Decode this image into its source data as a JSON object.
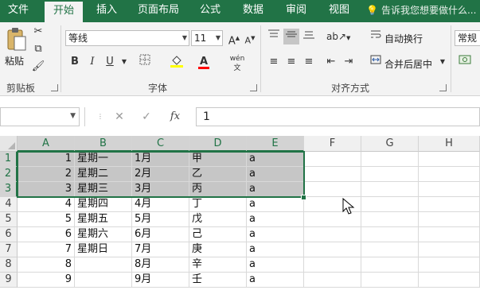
{
  "tabs": [
    {
      "label": "文件",
      "active": false
    },
    {
      "label": "开始",
      "active": true
    },
    {
      "label": "插入",
      "active": false
    },
    {
      "label": "页面布局",
      "active": false
    },
    {
      "label": "公式",
      "active": false
    },
    {
      "label": "数据",
      "active": false
    },
    {
      "label": "审阅",
      "active": false
    },
    {
      "label": "视图",
      "active": false
    }
  ],
  "tell_me": "告诉我您想要做什么...",
  "ribbon": {
    "clipboard": {
      "paste_label": "粘贴",
      "group_label": "剪贴板"
    },
    "font": {
      "name": "等线",
      "size": "11",
      "group_label": "字体",
      "bold": "B",
      "italic": "I",
      "underline": "U",
      "grow": "A",
      "shrink": "A",
      "font_color_glyph": "A",
      "phonetic_glyph": "wén"
    },
    "alignment": {
      "wrap_label": "自动换行",
      "merge_label": "合并后居中",
      "group_label": "对齐方式"
    },
    "number": {
      "format": "常规"
    }
  },
  "formula_bar": {
    "name_box": "",
    "fx": "fx",
    "value": "1"
  },
  "grid": {
    "columns": [
      "A",
      "B",
      "C",
      "D",
      "E",
      "F",
      "G",
      "H"
    ],
    "selected_columns": [
      "A",
      "B",
      "C",
      "D",
      "E"
    ],
    "rows": [
      "1",
      "2",
      "3",
      "4",
      "5",
      "6",
      "7",
      "8",
      "9"
    ],
    "selected_rows": [
      "1",
      "2",
      "3"
    ],
    "cells": [
      [
        "1",
        "星期一",
        "1月",
        "甲",
        "a"
      ],
      [
        "2",
        "星期二",
        "2月",
        "乙",
        "a"
      ],
      [
        "3",
        "星期三",
        "3月",
        "丙",
        "a"
      ],
      [
        "4",
        "星期四",
        "4月",
        "丁",
        "a"
      ],
      [
        "5",
        "星期五",
        "5月",
        "戊",
        "a"
      ],
      [
        "6",
        "星期六",
        "6月",
        "己",
        "a"
      ],
      [
        "7",
        "星期日",
        "7月",
        "庚",
        "a"
      ],
      [
        "8",
        "",
        "8月",
        "辛",
        "a"
      ],
      [
        "9",
        "",
        "9月",
        "壬",
        "a"
      ]
    ]
  },
  "colors": {
    "accent": "#217346",
    "selection": "#c6c6c6",
    "header_selected": "#d3d3d3"
  }
}
